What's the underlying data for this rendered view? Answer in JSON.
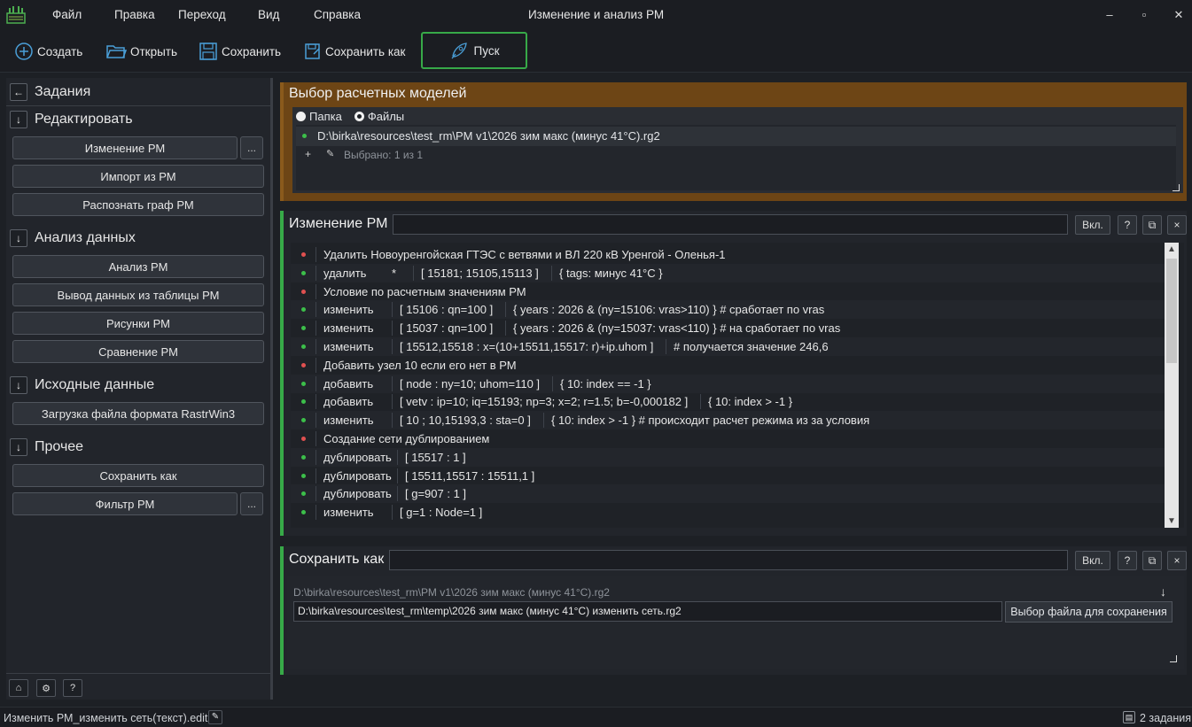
{
  "menu": {
    "file": "Файл",
    "edit": "Правка",
    "go": "Переход",
    "view": "Вид",
    "help": "Справка"
  },
  "window_title": "Изменение и анализ РМ",
  "toolbar": {
    "create": "Создать",
    "open": "Открыть",
    "save": "Сохранить",
    "save_as": "Сохранить как",
    "run": "Пуск"
  },
  "sidebar": {
    "title": "Задания",
    "sections": [
      {
        "label": "Редактировать",
        "items": [
          "Изменение РМ",
          "Импорт из РМ",
          "Распознать граф РМ"
        ]
      },
      {
        "label": "Анализ данных",
        "items": [
          "Анализ РМ",
          "Вывод данных из таблицы РМ",
          "Рисунки РМ",
          "Сравнение РМ"
        ]
      },
      {
        "label": "Исходные данные",
        "items": [
          "Загрузка файла формата RastrWin3"
        ]
      },
      {
        "label": "Прочее",
        "items": [
          "Сохранить как",
          "Фильтр РМ"
        ]
      }
    ],
    "dots": "..."
  },
  "panel_models": {
    "title": "Выбор расчетных моделей",
    "radio_folder": "Папка",
    "radio_files": "Файлы",
    "file": "D:\\birka\\resources\\test_rm\\РМ v1\\2026 зим макс (минус 41°C).rg2",
    "selected": "Выбрано: 1 из 1",
    "plus": "+"
  },
  "panel_edit": {
    "title": "Изменение РМ",
    "on_label": "Вкл.",
    "help_label": "?",
    "close_label": "×",
    "rows": [
      {
        "color": "#e05050",
        "s1": "Удалить Новоуренгойская ГТЭС с ветвями и ВЛ 220 кВ Уренгой - Оленья-1",
        "s2": "",
        "s3": "",
        "s4": ""
      },
      {
        "color": "#3cbf4a",
        "s1": "удалить",
        "s2": "*",
        "s3": "[ 15181; 15105,15113 ]",
        "s4": "{ tags: минус 41°C }"
      },
      {
        "color": "#e05050",
        "s1": "Условие по расчетным значениям РМ",
        "s2": "",
        "s3": "",
        "s4": ""
      },
      {
        "color": "#3cbf4a",
        "s1": "изменить",
        "s2": "",
        "s3": "[ 15106    :   qn=100 ]",
        "s4": "{ years : 2026 & (ny=15106: vras>110) }  # сработает по vras"
      },
      {
        "color": "#3cbf4a",
        "s1": "изменить",
        "s2": "",
        "s3": "[ 15037    :   qn=100 ]",
        "s4": "{ years : 2026 & (ny=15037: vras<110) }  # на сработает по vras"
      },
      {
        "color": "#3cbf4a",
        "s1": "изменить",
        "s2": "",
        "s3": "[ 15512,15518   :   x=(10+15511,15517: r)+ip.uhom ]",
        "s4": "# получается значение 246,6"
      },
      {
        "color": "#e05050",
        "s1": "Добавить узел 10 если его нет в РМ",
        "s2": "",
        "s3": "",
        "s4": ""
      },
      {
        "color": "#3cbf4a",
        "s1": "добавить",
        "s2": "",
        "s3": "[ node      :   ny=10; uhom=110 ]",
        "s4": "{ 10: index == -1 }"
      },
      {
        "color": "#3cbf4a",
        "s1": "добавить",
        "s2": "",
        "s3": "[ vetv       :   ip=10; iq=15193; np=3; x=2; r=1.5; b=-0,000182 ]",
        "s4": "{ 10: index > -1 }"
      },
      {
        "color": "#3cbf4a",
        "s1": "изменить",
        "s2": "",
        "s3": "[ 10 ; 10,15193,3   :   sta=0   ]",
        "s4": "{ 10: index > -1 }  # происходит расчет режима из за условия"
      },
      {
        "color": "#e05050",
        "s1": "Создание сети дублированием",
        "s2": "",
        "s3": "",
        "s4": ""
      },
      {
        "color": "#3cbf4a",
        "s1": "дублировать",
        "s2": "",
        "s3": "[ 15517    :   1          ]",
        "s4": ""
      },
      {
        "color": "#3cbf4a",
        "s1": "дублировать",
        "s2": "",
        "s3": "[ 15511,15517   :   15511,1 ]",
        "s4": ""
      },
      {
        "color": "#3cbf4a",
        "s1": "дублировать",
        "s2": "",
        "s3": "[ g=907    :   1          ]",
        "s4": ""
      },
      {
        "color": "#3cbf4a",
        "s1": "изменить",
        "s2": "",
        "s3": "[ g=1        :   Node=1 ]",
        "s4": ""
      }
    ]
  },
  "panel_save": {
    "title": "Сохранить как",
    "on_label": "Вкл.",
    "help_label": "?",
    "close_label": "×",
    "source": "D:\\birka\\resources\\test_rm\\РМ v1\\2026 зим макс (минус 41°C).rg2",
    "target": "D:\\birka\\resources\\test_rm\\temp\\2026 зим макс (минус 41°C) изменить сеть.rg2",
    "choose_label": "Выбор файла для сохранения",
    "arrow": "↓"
  },
  "status": {
    "left": "Изменить РМ_изменить сеть(текст).edit",
    "right": "2 задания"
  },
  "colors": {
    "accent_green": "#37a948",
    "orange": "#6d4515",
    "red_dot": "#e05050",
    "green_dot": "#3cbf4a"
  }
}
